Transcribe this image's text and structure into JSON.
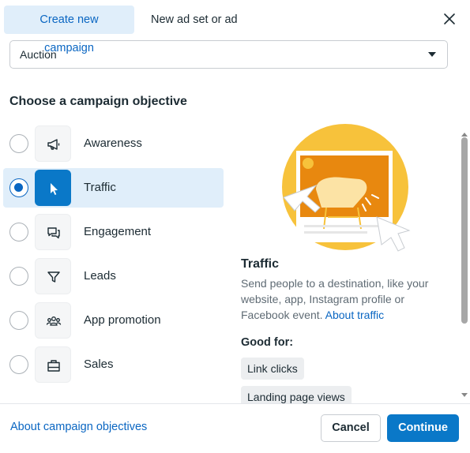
{
  "tabs": [
    {
      "label": "Create new campaign",
      "active": true
    },
    {
      "label": "New ad set or ad",
      "active": false
    }
  ],
  "buying_type": {
    "value": "Auction"
  },
  "section_title": "Choose a campaign objective",
  "objectives": [
    {
      "label": "Awareness",
      "icon": "megaphone-icon",
      "selected": false
    },
    {
      "label": "Traffic",
      "icon": "cursor-icon",
      "selected": true
    },
    {
      "label": "Engagement",
      "icon": "chat-bubbles-icon",
      "selected": false
    },
    {
      "label": "Leads",
      "icon": "funnel-icon",
      "selected": false
    },
    {
      "label": "App promotion",
      "icon": "people-icon",
      "selected": false
    },
    {
      "label": "Sales",
      "icon": "shopping-bag-icon",
      "selected": false
    }
  ],
  "detail": {
    "title": "Traffic",
    "description": "Send people to a destination, like your website, app, Instagram profile or Facebook event.",
    "link": "About traffic",
    "good_for_label": "Good for:",
    "good_for": [
      "Link clicks",
      "Landing page views"
    ]
  },
  "footer": {
    "link": "About campaign objectives",
    "cancel": "Cancel",
    "continue": "Continue"
  },
  "colors": {
    "accent": "#0a78c8",
    "selected_bg": "#e0eefa",
    "illustration_yellow": "#f7c23b",
    "illustration_orange": "#e8880f"
  }
}
